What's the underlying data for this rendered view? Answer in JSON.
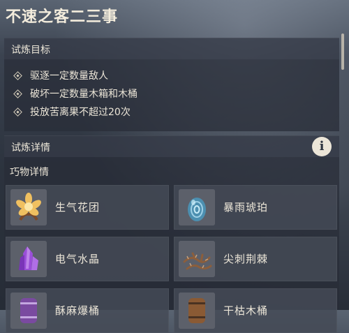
{
  "title": "不速之客二三事",
  "goals_section": {
    "label": "试炼目标",
    "goals": [
      "驱逐一定数量敌人",
      "破坏一定数量木箱和木桶",
      "投放苦离果不超过20次"
    ]
  },
  "details_section": {
    "label": "试炼详情",
    "info_glyph": "i",
    "subhead": "巧物详情",
    "items": [
      {
        "name": "生气花团",
        "icon": "flower-cluster-icon"
      },
      {
        "name": "暴雨琥珀",
        "icon": "blue-egg-icon"
      },
      {
        "name": "电气水晶",
        "icon": "purple-crystal-icon"
      },
      {
        "name": "尖刺荆棘",
        "icon": "thorn-bramble-icon"
      },
      {
        "name": "酥麻爆桶",
        "icon": "explosive-barrel-icon"
      },
      {
        "name": "干枯木桶",
        "icon": "wooden-barrel-icon"
      }
    ]
  },
  "colors": {
    "accent_text": "#ece6d8",
    "card_bg": "#444a56",
    "header_bg": "#343a46"
  }
}
